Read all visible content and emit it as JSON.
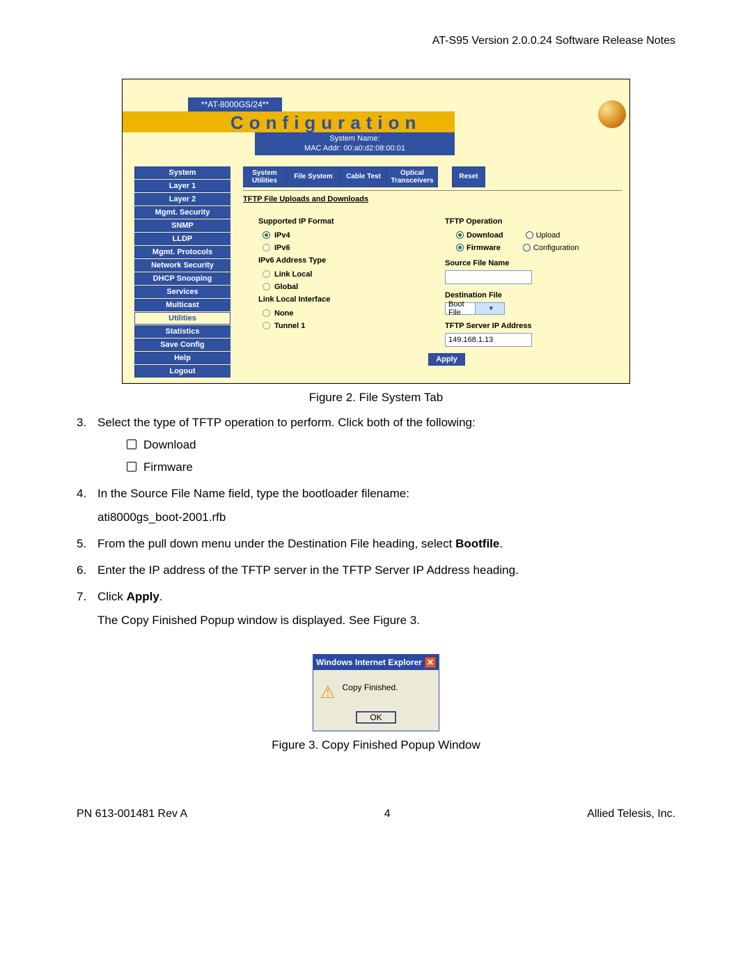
{
  "header": {
    "right": "AT-S95 Version 2.0.0.24 Software Release Notes"
  },
  "figure2": {
    "device": "**AT-8000GS/24**",
    "banner": "Configuration",
    "systemNameLabel": "System Name:",
    "macLabel": "MAC Addr:  00:a0:d2:08:00:01",
    "sidebar": [
      "System",
      "Layer 1",
      "Layer 2",
      "Mgmt. Security",
      "SNMP",
      "LLDP",
      "Mgmt. Protocols",
      "Network Security",
      "DHCP Snooping",
      "Services",
      "Multicast",
      "Utilities",
      "Statistics",
      "Save Config",
      "Help",
      "Logout"
    ],
    "sidebarLightIdx": 11,
    "tabs": [
      "System Utilities",
      "File System",
      "Cable Test",
      "Optical Transceivers",
      "Reset"
    ],
    "sectionTitle": "TFTP File Uploads and Downloads",
    "left": {
      "supportedTitle": "Supported IP Format",
      "ipv4": "IPv4",
      "ipv6": "IPv6",
      "addrTypeTitle": "IPv6 Address Type",
      "linkLocal": "Link Local",
      "global": "Global",
      "ifaceTitle": "Link Local Interface",
      "none": "None",
      "tunnel1": "Tunnel 1"
    },
    "right": {
      "opTitle": "TFTP Operation",
      "download": "Download",
      "upload": "Upload",
      "firmware": "Firmware",
      "configuration": "Configuration",
      "srcLabel": "Source File Name",
      "srcValue": "",
      "dstLabel": "Destination File",
      "dstValue": "Boot File",
      "serverLabel": "TFTP Server IP Address",
      "serverValue": "149.168.1.13"
    },
    "apply": "Apply",
    "caption": "Figure 2. File System Tab"
  },
  "steps": {
    "s3": "Select the type of TFTP operation to perform. Click both of the following:",
    "s3a": "Download",
    "s3b": "Firmware",
    "s4": "In the Source File Name field, type the bootloader filename:",
    "s4file": "ati8000gs_boot-2001.rfb",
    "s5a": "From the pull down menu under the Destination File heading, select ",
    "s5b": "Bootfile",
    "s5c": ".",
    "s6": "Enter the IP address of the TFTP server in the TFTP Server IP Address heading.",
    "s7a": "Click ",
    "s7b": "Apply",
    "s7c": ".",
    "s7d": "The Copy Finished Popup window is displayed. See Figure 3."
  },
  "popup": {
    "title": "Windows Internet Explorer",
    "msg": "Copy Finished.",
    "ok": "OK",
    "caption": "Figure 3. Copy Finished Popup Window"
  },
  "footer": {
    "left": "PN 613-001481 Rev A",
    "center": "4",
    "right": "Allied Telesis, Inc."
  }
}
